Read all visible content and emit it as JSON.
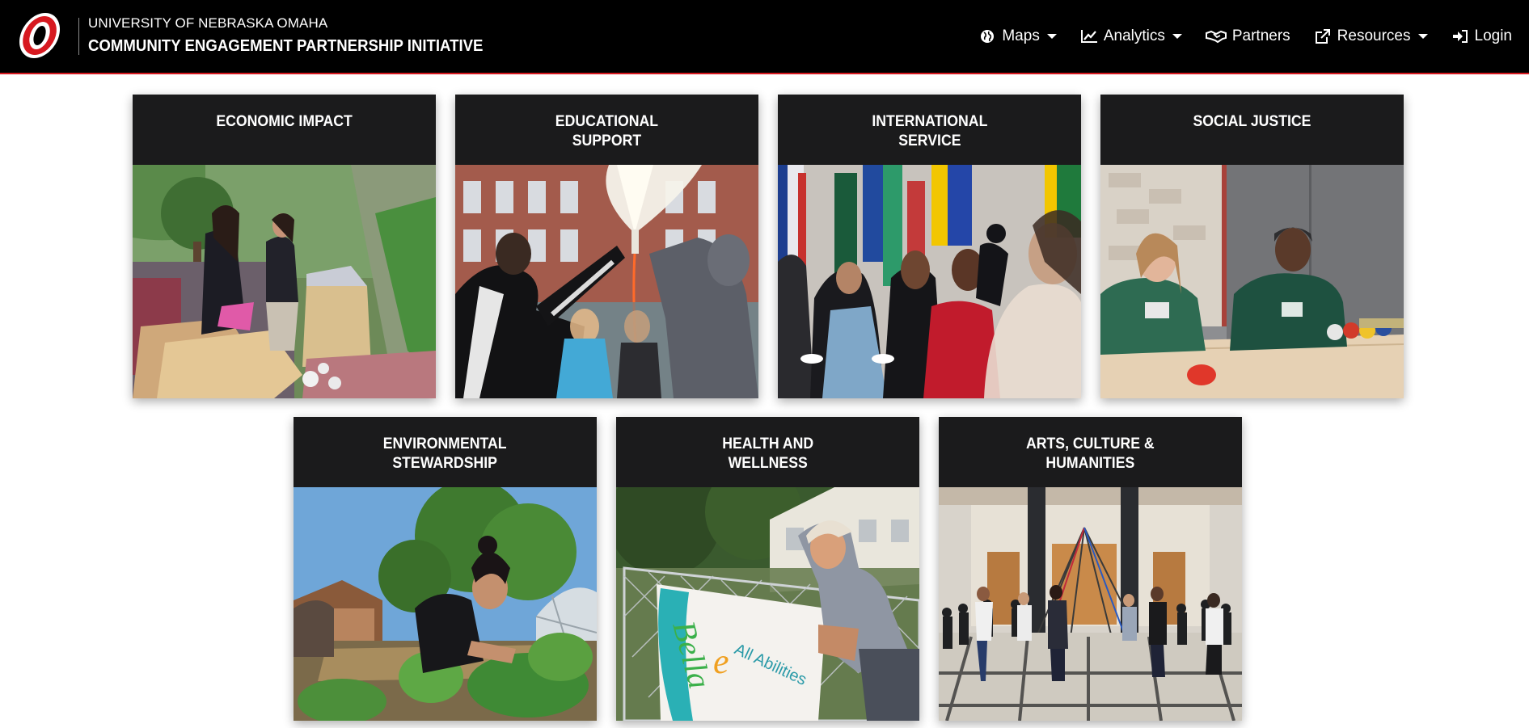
{
  "header": {
    "university": "UNIVERSITY OF NEBRASKA OMAHA",
    "initiative": "COMMUNITY ENGAGEMENT PARTNERSHIP INITIATIVE",
    "accent_color": "#d71920"
  },
  "nav": {
    "maps": {
      "label": "Maps",
      "icon": "globe-icon"
    },
    "analytics": {
      "label": "Analytics",
      "icon": "line-chart-icon"
    },
    "partners": {
      "label": "Partners",
      "icon": "handshake-icon"
    },
    "resources": {
      "label": "Resources",
      "icon": "external-link-icon"
    },
    "login": {
      "label": "Login",
      "icon": "sign-in-icon"
    }
  },
  "cards": [
    {
      "title": "ECONOMIC IMPACT"
    },
    {
      "title": "EDUCATIONAL\nSUPPORT"
    },
    {
      "title": "INTERNATIONAL\nSERVICE"
    },
    {
      "title": "SOCIAL JUSTICE"
    },
    {
      "title": "ENVIRONMENTAL\nSTEWARDSHIP"
    },
    {
      "title": "HEALTH AND\nWELLNESS"
    },
    {
      "title": "ARTS, CULTURE &\nHUMANITIES"
    }
  ]
}
